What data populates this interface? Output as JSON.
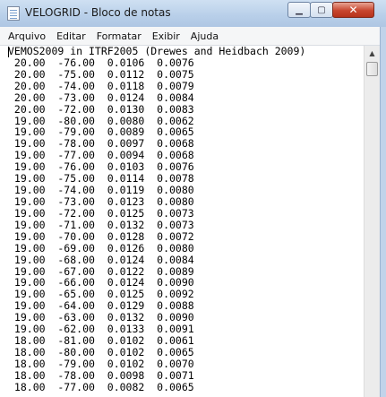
{
  "window": {
    "title": "VELOGRID - Bloco de notas",
    "minimize_glyph": "▁",
    "maximize_glyph": "▢",
    "close_glyph": "✕"
  },
  "menu": [
    "Arquivo",
    "Editar",
    "Formatar",
    "Exibir",
    "Ajuda"
  ],
  "document": {
    "lines": [
      "VEMOS2009 in ITRF2005 (Drewes and Heidbach 2009)",
      " 20.00  -76.00  0.0106  0.0076",
      " 20.00  -75.00  0.0112  0.0075",
      " 20.00  -74.00  0.0118  0.0079",
      " 20.00  -73.00  0.0124  0.0084",
      " 20.00  -72.00  0.0130  0.0083",
      " 19.00  -80.00  0.0080  0.0062",
      " 19.00  -79.00  0.0089  0.0065",
      " 19.00  -78.00  0.0097  0.0068",
      " 19.00  -77.00  0.0094  0.0068",
      " 19.00  -76.00  0.0103  0.0076",
      " 19.00  -75.00  0.0114  0.0078",
      " 19.00  -74.00  0.0119  0.0080",
      " 19.00  -73.00  0.0123  0.0080",
      " 19.00  -72.00  0.0125  0.0073",
      " 19.00  -71.00  0.0132  0.0073",
      " 19.00  -70.00  0.0128  0.0072",
      " 19.00  -69.00  0.0126  0.0080",
      " 19.00  -68.00  0.0124  0.0084",
      " 19.00  -67.00  0.0122  0.0089",
      " 19.00  -66.00  0.0124  0.0090",
      " 19.00  -65.00  0.0125  0.0092",
      " 19.00  -64.00  0.0129  0.0088",
      " 19.00  -63.00  0.0132  0.0090",
      " 19.00  -62.00  0.0133  0.0091",
      " 18.00  -81.00  0.0102  0.0061",
      " 18.00  -80.00  0.0102  0.0065",
      " 18.00  -79.00  0.0102  0.0070",
      " 18.00  -78.00  0.0098  0.0071",
      " 18.00  -77.00  0.0082  0.0065"
    ]
  },
  "scrollbar": {
    "up_glyph": "▲"
  }
}
